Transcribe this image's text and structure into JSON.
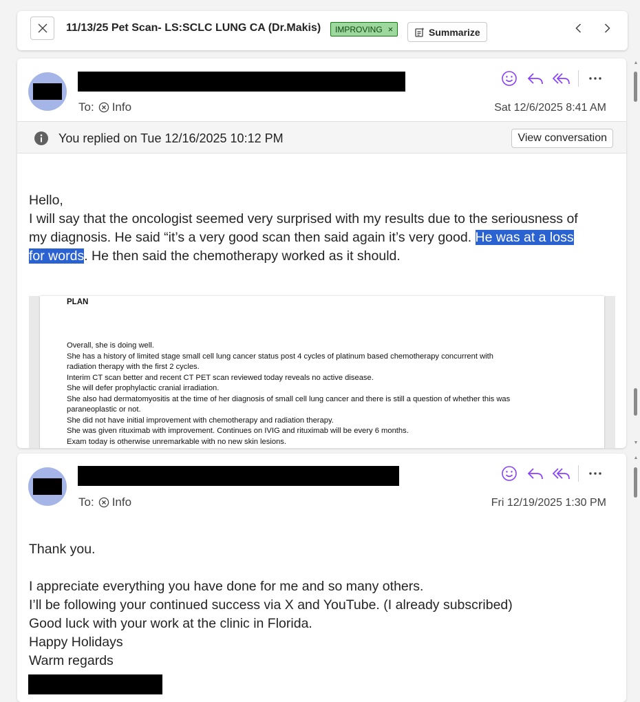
{
  "header": {
    "subject": "11/13/25 Pet Scan- LS:SCLC LUNG CA (Dr.Makis)",
    "tag_label": "IMPROVING",
    "tag_remove": "×",
    "summarize_label": "Summarize"
  },
  "message1": {
    "to_label": "To:",
    "recipient": "Info",
    "date": "Sat 12/6/2025 8:41 AM",
    "replied_text": "You replied on Tue 12/16/2025 10:12 PM",
    "view_conversation_label": "View conversation",
    "greeting": "Hello,",
    "line1": "I will say that the oncologist seemed very surprised with my results due to the seriousness of",
    "line2_pre": "my diagnosis. He said “it’s a very good scan then said again it’s very good. ",
    "line2_hl": "He was at a loss ",
    "line3_hl": "for words",
    "line3_post": ". He then said the chemotherapy worked as it should.",
    "attachment": {
      "heading": "PLAN",
      "lines": [
        "Overall, she is doing well.",
        "She has a history of limited stage small cell lung cancer status post 4 cycles of platinum based chemotherapy concurrent with",
        "radiation therapy with the first 2 cycles.",
        "Interim CT scan better and recent CT PET scan reviewed today reveals no active disease.",
        "She will defer prophylactic cranial irradiation.",
        "She also had dermatomyositis at the time of her diagnosis of small cell lung cancer and there is still a question of whether this was",
        "paraneoplastic or not.",
        "She did not have initial improvement with chemotherapy and radiation therapy.",
        "She was given rituximab with improvement. Continues on IVIG and rituximab will be every 6 months.",
        "Exam today is otherwise unremarkable with no new skin lesions."
      ]
    }
  },
  "message2": {
    "to_label": "To:",
    "recipient": "Info",
    "date": "Fri 12/19/2025 1:30 PM",
    "lines": [
      "Thank you.",
      "",
      "I appreciate everything you have done for me and so many others.",
      "I’ll be following your continued success via X and YouTube. (I already subscribed)",
      "Good luck with your work at the clinic in Florida.",
      "Happy Holidays",
      "Warm regards"
    ]
  },
  "colors": {
    "accent": "#8a3ffc",
    "highlight": "#2b62d1",
    "tag_bg": "#9fd89f",
    "avatar": "#a5b5e8"
  },
  "icons": {
    "close": "close-icon",
    "summarize": "summarize-icon",
    "prev": "chevron-left-icon",
    "next": "chevron-right-icon",
    "emoji": "emoji-icon",
    "reply": "reply-icon",
    "reply_all": "reply-all-icon",
    "more": "more-icon",
    "info": "info-icon",
    "recipient": "remove-recipient-icon"
  }
}
